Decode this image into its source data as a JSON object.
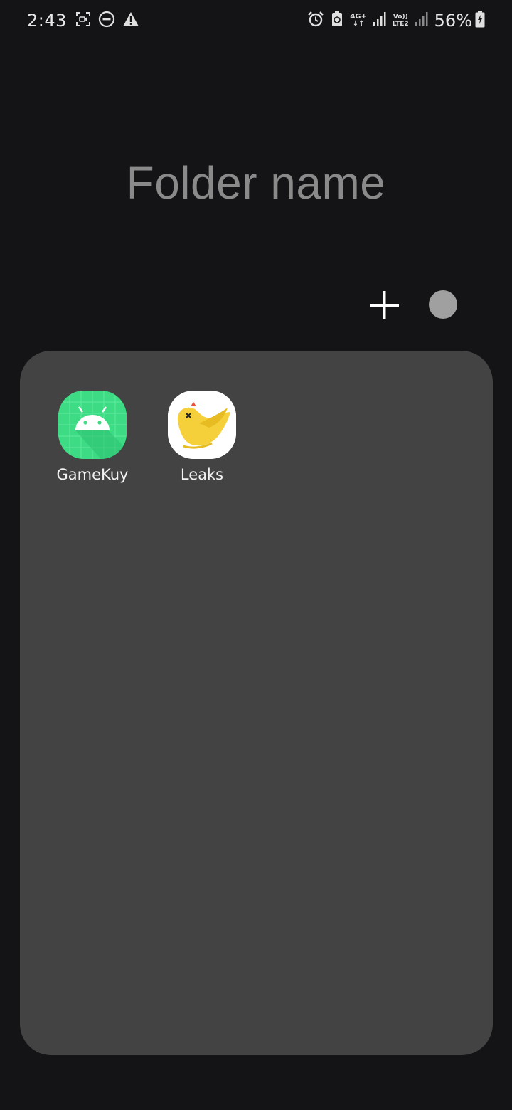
{
  "status_bar": {
    "time": "2:43",
    "network_type": "4G+",
    "volte_line1": "Vo))",
    "volte_line2": "LTE2",
    "battery_percent": "56%",
    "icons": [
      "screen-record-icon",
      "do-not-disturb-icon",
      "warning-icon",
      "alarm-icon",
      "data-saver-icon",
      "signal-icon",
      "battery-icon"
    ]
  },
  "folder": {
    "name": "Folder name"
  },
  "actions": {
    "add_icon": "plus-icon",
    "color_swatch": "#a0a0a0"
  },
  "apps": [
    {
      "label": "GameKuy",
      "icon": "android-icon",
      "color": "#3ddc84"
    },
    {
      "label": "Leaks",
      "icon": "yellow-bird-icon",
      "color": "#f5d03b"
    }
  ],
  "colors": {
    "background": "#141315",
    "panel": "#434343",
    "folder_title": "#8a8a8a"
  }
}
